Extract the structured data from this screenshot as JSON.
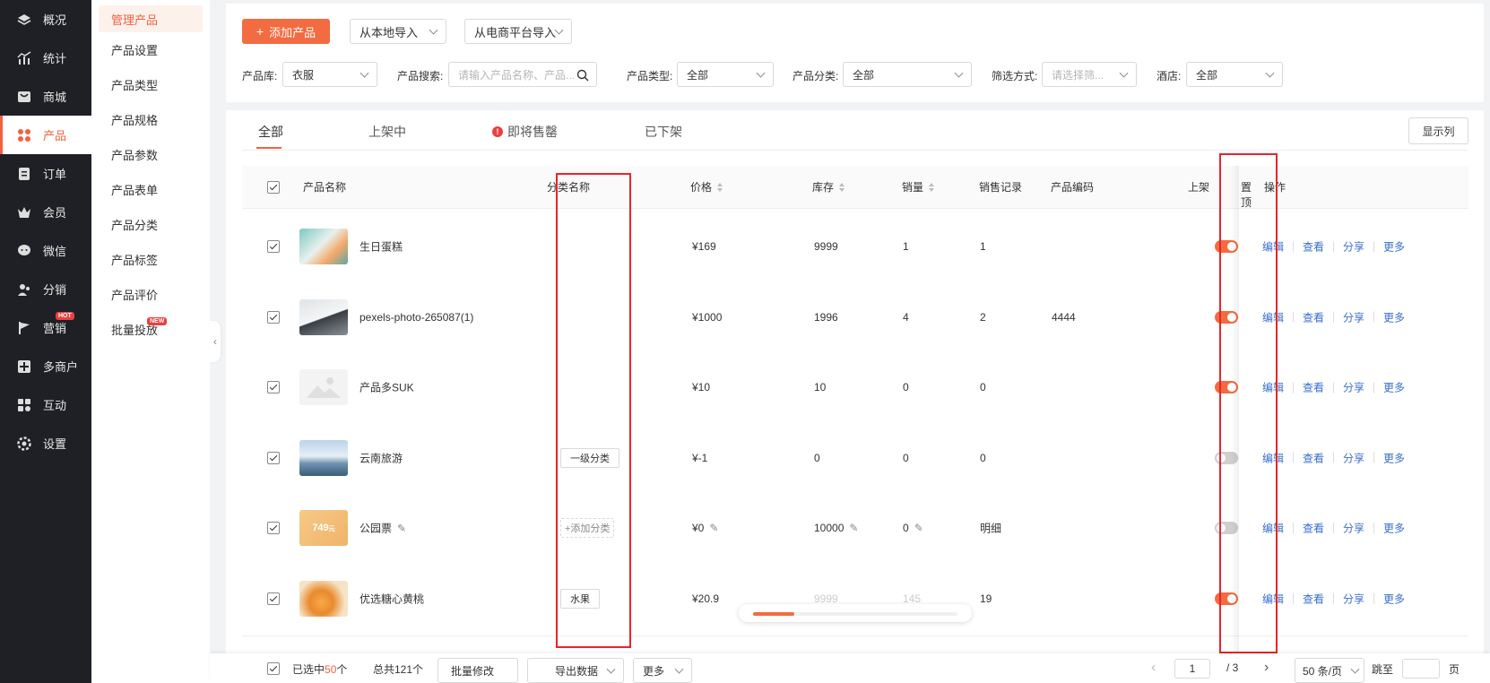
{
  "sidebar": {
    "items": [
      {
        "label": "概况",
        "icon": "layers-icon"
      },
      {
        "label": "统计",
        "icon": "stats-icon"
      },
      {
        "label": "商城",
        "icon": "store-icon"
      },
      {
        "label": "产品",
        "icon": "product-icon",
        "active": true
      },
      {
        "label": "订单",
        "icon": "order-icon"
      },
      {
        "label": "会员",
        "icon": "crown-icon"
      },
      {
        "label": "微信",
        "icon": "wechat-icon"
      },
      {
        "label": "分销",
        "icon": "distribution-icon"
      },
      {
        "label": "营销",
        "icon": "flag-icon",
        "badge": "HOT"
      },
      {
        "label": "多商户",
        "icon": "merchant-icon"
      },
      {
        "label": "互动",
        "icon": "interact-icon"
      },
      {
        "label": "设置",
        "icon": "gear-icon"
      }
    ]
  },
  "subnav": {
    "items": [
      "管理产品",
      "产品设置",
      "产品类型",
      "产品规格",
      "产品参数",
      "产品表单",
      "产品分类",
      "产品标签",
      "产品评价",
      "批量投放"
    ],
    "badge": "NEW"
  },
  "toolbar": {
    "add_label": "添加产品",
    "import_local": "从本地导入",
    "import_platform": "从电商平台导入"
  },
  "filters": {
    "library_label": "产品库:",
    "library_value": "衣服",
    "search_label": "产品搜索:",
    "search_placeholder": "请输入产品名称、产品...",
    "type_label": "产品类型:",
    "type_value": "全部",
    "category_label": "产品分类:",
    "category_value": "全部",
    "filter_label": "筛选方式:",
    "filter_placeholder": "请选择筛...",
    "hotel_label": "酒店:",
    "hotel_value": "全部"
  },
  "tabs": [
    "全部",
    "上架中",
    "即将售罄",
    "已下架"
  ],
  "show_columns": "显示列",
  "columns": {
    "name": "产品名称",
    "category": "分类名称",
    "price": "价格",
    "stock": "库存",
    "sales": "销量",
    "records": "销售记录",
    "code": "产品编码",
    "listed": "上架",
    "pinned": "置顶",
    "ops": "操作"
  },
  "ops": [
    "编辑",
    "查看",
    "分享",
    "更多"
  ],
  "rows": [
    {
      "name": "生日蛋糕",
      "category": "",
      "price": "¥169",
      "stock": "9999",
      "sales": "1",
      "records": "1",
      "code": "",
      "listed": true,
      "pinned": false
    },
    {
      "name": "pexels-photo-265087(1)",
      "category": "",
      "price": "¥1000",
      "stock": "1996",
      "sales": "4",
      "records": "2",
      "code": "4444",
      "listed": true,
      "pinned": false
    },
    {
      "name": "产品多SUK",
      "category": "",
      "price": "¥10",
      "stock": "10",
      "sales": "0",
      "records": "0",
      "code": "",
      "listed": true,
      "pinned": false
    },
    {
      "name": "云南旅游",
      "category": "一级分类",
      "price": "¥-1",
      "stock": "0",
      "sales": "0",
      "records": "0",
      "code": "",
      "listed": false,
      "pinned": true
    },
    {
      "name": "公园票",
      "category": "+添加分类",
      "price": "¥0",
      "stock": "10000",
      "sales": "0",
      "records": "明细",
      "code": "",
      "listed": false,
      "pinned": false,
      "thumb_text": "749",
      "thumb_sub": "元"
    },
    {
      "name": "优选糖心黄桃",
      "category": "水果",
      "price": "¥20.9",
      "stock": "9999",
      "sales": "145",
      "records": "19",
      "code": "",
      "listed": true,
      "pinned": true
    }
  ],
  "scroll_progress": 0.2,
  "footer": {
    "selected_prefix": "已选中",
    "selected_count": "50",
    "selected_suffix": "个",
    "total": "总共121个",
    "batch_edit": "批量修改",
    "export": "导出数据",
    "more": "更多",
    "page": "1",
    "page_total": "/ 3",
    "page_size": "50 条/页",
    "jump_label": "跳至",
    "page_unit": "页"
  }
}
